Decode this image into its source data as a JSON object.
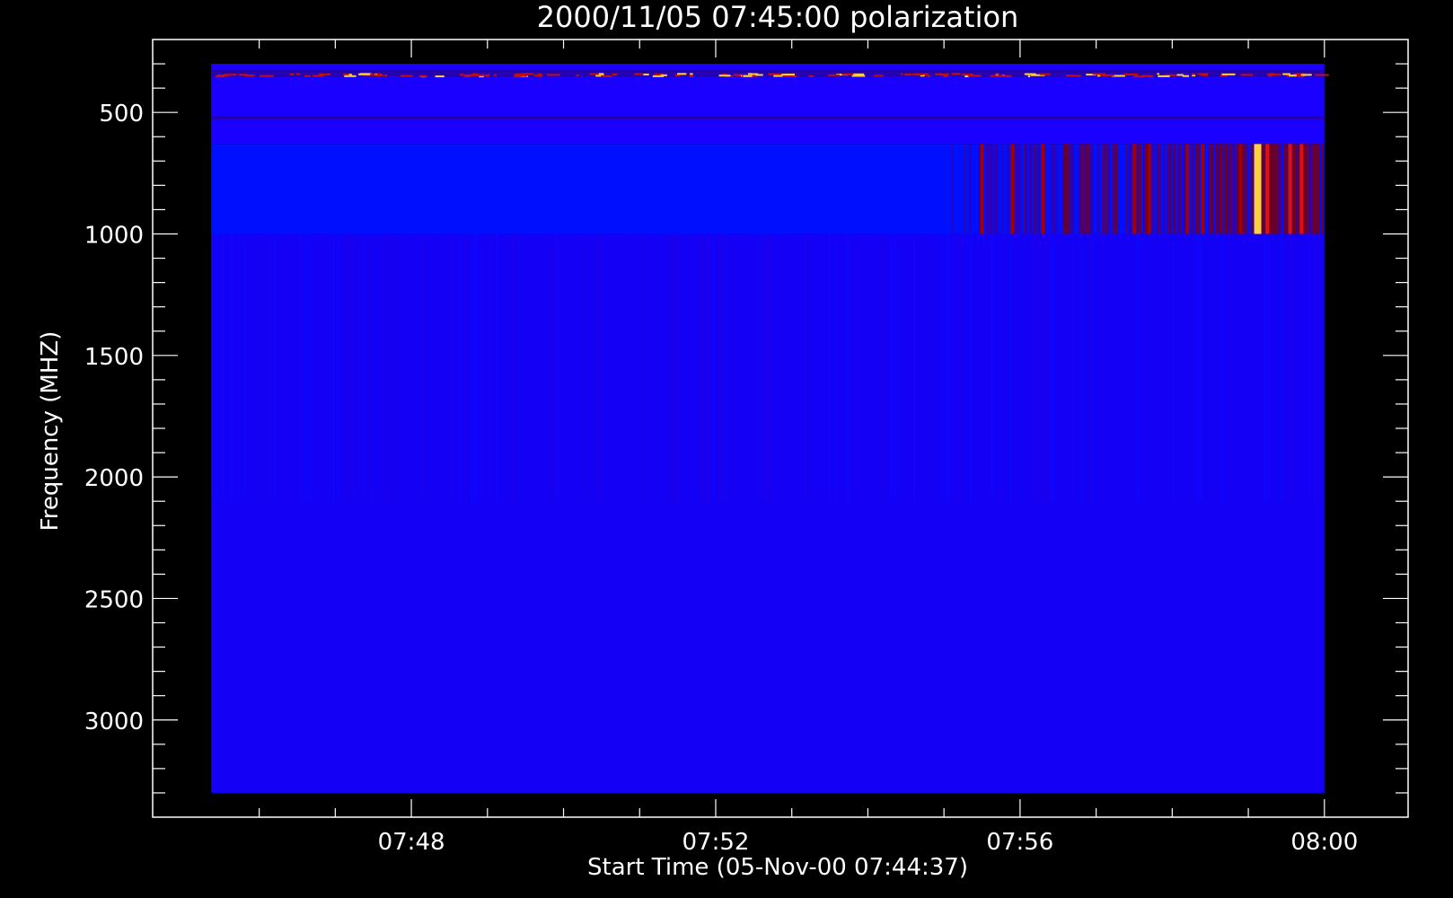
{
  "chart_data": {
    "type": "heatmap",
    "title": "2000/11/05 07:45:00 polarization",
    "xlabel": "Start Time (05-Nov-00 07:44:37)",
    "ylabel": "Frequency (MHZ)",
    "x_ticks": [
      {
        "label": "07:48",
        "minute": 48
      },
      {
        "label": "07:52",
        "minute": 52
      },
      {
        "label": "07:56",
        "minute": 56
      },
      {
        "label": "08:00",
        "minute": 60
      }
    ],
    "y_ticks": [
      500,
      1000,
      1500,
      2000,
      2500,
      3000
    ],
    "xlim_minutes": [
      44.6,
      61.1
    ],
    "ylim_mhz": [
      200,
      3400
    ],
    "image_extent": {
      "minute_start": 45.37,
      "minute_end": 60.0,
      "mhz_start": 300,
      "mhz_end": 3300
    },
    "bands": [
      {
        "mhz_start": 300,
        "mhz_end": 630,
        "color": "#1a00ff"
      },
      {
        "mhz_start": 630,
        "mhz_end": 1000,
        "color": "#0010ff"
      },
      {
        "mhz_start": 1000,
        "mhz_end": 3300,
        "color": "#1400f4"
      }
    ],
    "noise_line_mhz": [
      345,
      330,
      520
    ],
    "burst_region": {
      "mhz_start": 630,
      "mhz_end": 1000,
      "minute_start": 55.0,
      "minute_end": 60.0,
      "events": [
        {
          "minute": 55.5,
          "level": 0.6
        },
        {
          "minute": 55.9,
          "level": 0.55
        },
        {
          "minute": 56.3,
          "level": 0.5
        },
        {
          "minute": 57.5,
          "level": 0.65
        },
        {
          "minute": 57.7,
          "level": 0.6
        },
        {
          "minute": 58.2,
          "level": 0.55
        },
        {
          "minute": 58.4,
          "level": 0.7
        },
        {
          "minute": 58.9,
          "level": 0.6
        },
        {
          "minute": 59.1,
          "level": 1.0
        },
        {
          "minute": 59.25,
          "level": 0.85
        },
        {
          "minute": 59.55,
          "level": 0.8
        },
        {
          "minute": 59.7,
          "level": 0.75
        }
      ]
    },
    "colors": {
      "background": "#000000",
      "axes": "#ffffff",
      "low": "#0a00ff",
      "mid": "#a00000",
      "high": "#ffd040"
    }
  }
}
